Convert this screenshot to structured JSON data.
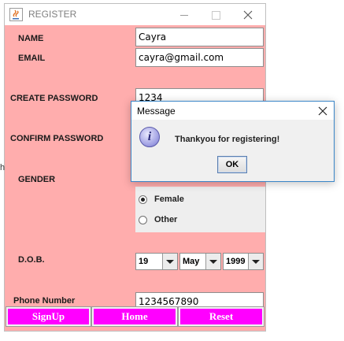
{
  "window": {
    "title": "REGISTER",
    "form_bg": "#ffadad"
  },
  "form": {
    "name_label": "NAME",
    "name_value": "Cayra",
    "email_label": "EMAIL",
    "email_value": "cayra@gmail.com",
    "create_password_label": "CREATE PASSWORD",
    "create_password_value": "1234",
    "confirm_password_label": "CONFIRM PASSWORD",
    "gender_label": "GENDER",
    "gender_options": [
      {
        "label": "Female",
        "selected": true
      },
      {
        "label": "Other",
        "selected": false
      }
    ],
    "dob_label": "D.O.B.",
    "dob_day": "19",
    "dob_month": "May",
    "dob_year": "1999",
    "phone_label": "Phone Number",
    "phone_value": "1234567890"
  },
  "buttons": {
    "signup": "SignUp",
    "home": "Home",
    "reset": "Reset",
    "color": "#ff00ff"
  },
  "dialog": {
    "title": "Message",
    "message": "Thankyou for registering!",
    "ok": "OK",
    "icon": "info-icon"
  }
}
